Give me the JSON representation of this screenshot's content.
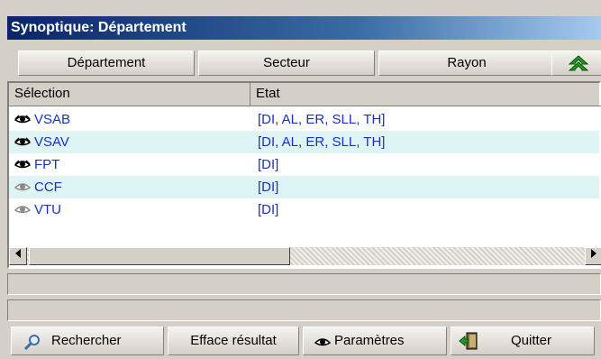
{
  "window": {
    "title": "Synoptique: Département"
  },
  "tabs": [
    {
      "label": "Département"
    },
    {
      "label": "Secteur"
    },
    {
      "label": "Rayon"
    },
    {
      "label": "",
      "icon": "double-up-arrow-icon",
      "color": "#1ea01e"
    }
  ],
  "grid": {
    "columns": [
      "Sélection",
      "Etat"
    ],
    "rows": [
      {
        "selection": "VSAB",
        "etat": "[DI, AL, ER, SLL, TH]",
        "eye": "active"
      },
      {
        "selection": "VSAV",
        "etat": "[DI, AL, ER, SLL, TH]",
        "eye": "active"
      },
      {
        "selection": "FPT",
        "etat": "[DI]",
        "eye": "active"
      },
      {
        "selection": "CCF",
        "etat": "[DI]",
        "eye": "inactive"
      },
      {
        "selection": "VTU",
        "etat": "[DI]",
        "eye": "inactive"
      }
    ]
  },
  "buttons": {
    "search": "Rechercher",
    "clear": "Efface résultat",
    "params": "Paramètres",
    "quit": "Quitter"
  },
  "colors": {
    "row_text": "#1b2fc4",
    "row_alt": "#dff4f4",
    "title_bg": "#0a246a"
  }
}
